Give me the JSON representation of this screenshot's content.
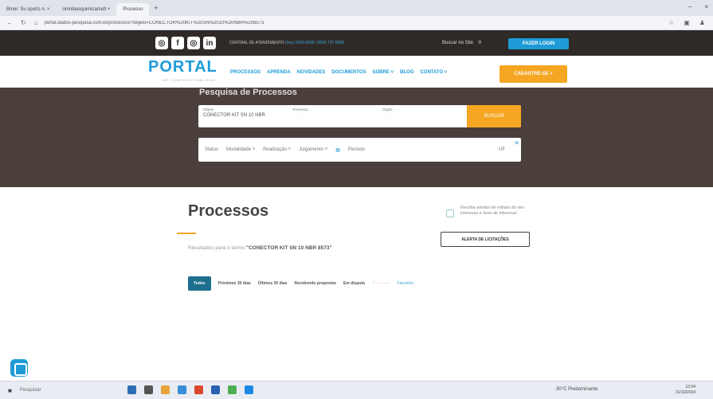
{
  "browser": {
    "tabs": [
      {
        "label": "Bmer. Su sports n. ×"
      },
      {
        "label": "omnibasquimicamult ×"
      },
      {
        "label": "Processo"
      }
    ],
    "new_tab": "+",
    "url": "portal.dados-pesquisa.com.br/processos?objeto=CONECTOR%20KIT%20SN%2010%20NBR%208573",
    "win_min": "–",
    "win_close": "×"
  },
  "top": {
    "social": [
      "◎",
      "f",
      "◎",
      "in"
    ],
    "central_label": "CENTRAL DE ATENDIMENTO",
    "central_phone": "(0xx) 3433-5658 | 0800 737 5658",
    "buscar_site": "Buscar no Site",
    "login": "FAZER LOGIN"
  },
  "nav": {
    "logo": "PORTAL",
    "logo_sub": "DE COMPRAS PÚBLICAS",
    "menu": [
      "PROCESSOS",
      "APRENDA",
      "NOVIDADES",
      "DOCUMENTOS",
      "SOBRE ˅",
      "BLOG",
      "CONTATO ˅"
    ],
    "cadastre": "CADASTRE-SE ˅"
  },
  "hero": {
    "title": "Pesquisa de Processos",
    "objeto_label": "Objeto",
    "objeto_value": "CONECTOR KIT SN 10 NBR",
    "processo_label": "Processo",
    "orgao_label": "Órgão",
    "buscar": "BUSCAR",
    "filters": [
      "Status",
      "Modalidade ˅",
      "Realização ˅",
      "Julgamento ˅",
      "Período"
    ],
    "uf": "UF",
    "close": "×"
  },
  "main": {
    "title": "Processos",
    "result_prefix": "Resultados para o termo ",
    "result_term": "\"CONECTOR KIT SN 10 NBR 8573\"",
    "alert_text": "Receba alertas de editais do seu interesse e área de interesse",
    "alert_button": "ALERTA DE LICITAÇÕES",
    "tabs": [
      "Todos",
      "Próximos 30 dias",
      "Últimos 30 dias",
      "Recebendo propostas",
      "Em disputa",
      "Favoritos"
    ]
  },
  "taskbar": {
    "start": "■",
    "search": "Pesquisar",
    "weather": "30°C Predominante",
    "time": "13:04",
    "date": "31/10/2024"
  },
  "colors": {
    "accent": "#1e9bd7",
    "orange": "#f5a623",
    "hero_bg": "#4a3f3b",
    "topstrip": "#2f2a27"
  }
}
